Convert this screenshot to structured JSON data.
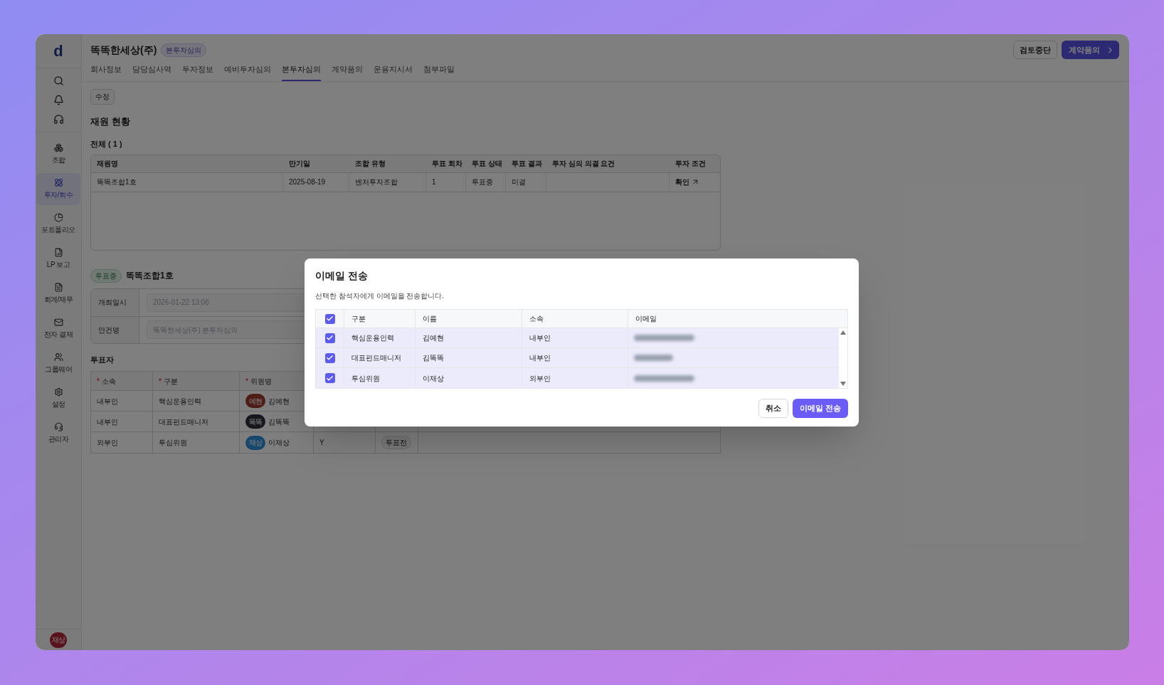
{
  "sidebar": {
    "logo": "d",
    "items": [
      {
        "kind": "group",
        "label": "조합",
        "selected": false
      },
      {
        "kind": "invest",
        "label": "투자/회수",
        "selected": true
      },
      {
        "kind": "pie",
        "label": "포트폴리오",
        "selected": false
      },
      {
        "kind": "report",
        "label": "LP 보고",
        "selected": false
      },
      {
        "kind": "money",
        "label": "회계/재무",
        "selected": false
      },
      {
        "kind": "mail",
        "label": "전자 결재",
        "selected": false
      },
      {
        "kind": "users",
        "label": "그룹웨어",
        "selected": false
      },
      {
        "kind": "settings",
        "label": "설정",
        "selected": false
      },
      {
        "kind": "admin",
        "label": "관리자",
        "selected": false
      }
    ],
    "avatar": "재상"
  },
  "header": {
    "title": "똑똑한세상(주)",
    "badge": "본투자심의",
    "stop_button": "검토중단",
    "next_button": "계약품의"
  },
  "tabs": [
    {
      "label": "회사정보",
      "selected": false
    },
    {
      "label": "담당심사역",
      "selected": false
    },
    {
      "label": "투자정보",
      "selected": false
    },
    {
      "label": "예비투자심의",
      "selected": false
    },
    {
      "label": "본투자심의",
      "selected": true
    },
    {
      "label": "계약품의",
      "selected": false
    },
    {
      "label": "운용지시서",
      "selected": false
    },
    {
      "label": "첨부파일",
      "selected": false
    }
  ],
  "edit_button": "수정",
  "section_title": "재원 현황",
  "total": "전체 ( 1 )",
  "fund_table": {
    "columns": [
      "재원명",
      "만기일",
      "조합 유형",
      "투표 회차",
      "투표 상태",
      "투표 결과",
      "투자 심의 의결 요건",
      "투자 조건"
    ],
    "rows": [
      {
        "cells": [
          "똑똑조합1호",
          "2025-08-19",
          "벤처투자조합",
          "1",
          "투표중",
          "미결"
        ],
        "link": "확인"
      }
    ]
  },
  "vote": {
    "status": "투표중",
    "title": "똑똑조합1호",
    "fields": [
      {
        "label": "개최일시",
        "value": "2026-01-22 13:06"
      },
      {
        "label": "안건명",
        "value": "똑똑한세상(주) 본투자심의"
      }
    ],
    "voters_title": "투표자",
    "columns": [
      {
        "mark": "*",
        "label": "소속"
      },
      {
        "mark": "*",
        "label": "구분"
      },
      {
        "mark": "*",
        "label": "위원명"
      }
    ],
    "rows": [
      {
        "affiliation": "내부인",
        "role": "핵심운용인력",
        "avatar": "예현",
        "name": "김예현"
      },
      {
        "affiliation": "내부인",
        "role": "대표펀드매니저",
        "avatar": "똑똑",
        "name": "김똑똑"
      },
      {
        "affiliation": "외부인",
        "role": "투심위원",
        "avatar": "재상",
        "name": "이재상",
        "vote": "Y",
        "status": "투표전"
      }
    ]
  },
  "modal": {
    "title": "이메일 전송",
    "description": "선택한 참석자에게 이메일을 전송합니다.",
    "all_checked": true,
    "columns": [
      "구분",
      "이름",
      "소속",
      "이메일"
    ],
    "rows": [
      {
        "checked": true,
        "role": "핵심운용인력",
        "name": "김예현",
        "affiliation": "내부인"
      },
      {
        "checked": true,
        "role": "대표펀드매니저",
        "name": "김똑똑",
        "affiliation": "내부인"
      },
      {
        "checked": true,
        "role": "투심위원",
        "name": "이재상",
        "affiliation": "외부인"
      }
    ],
    "cancel": "취소",
    "send": "이메일 전송"
  }
}
